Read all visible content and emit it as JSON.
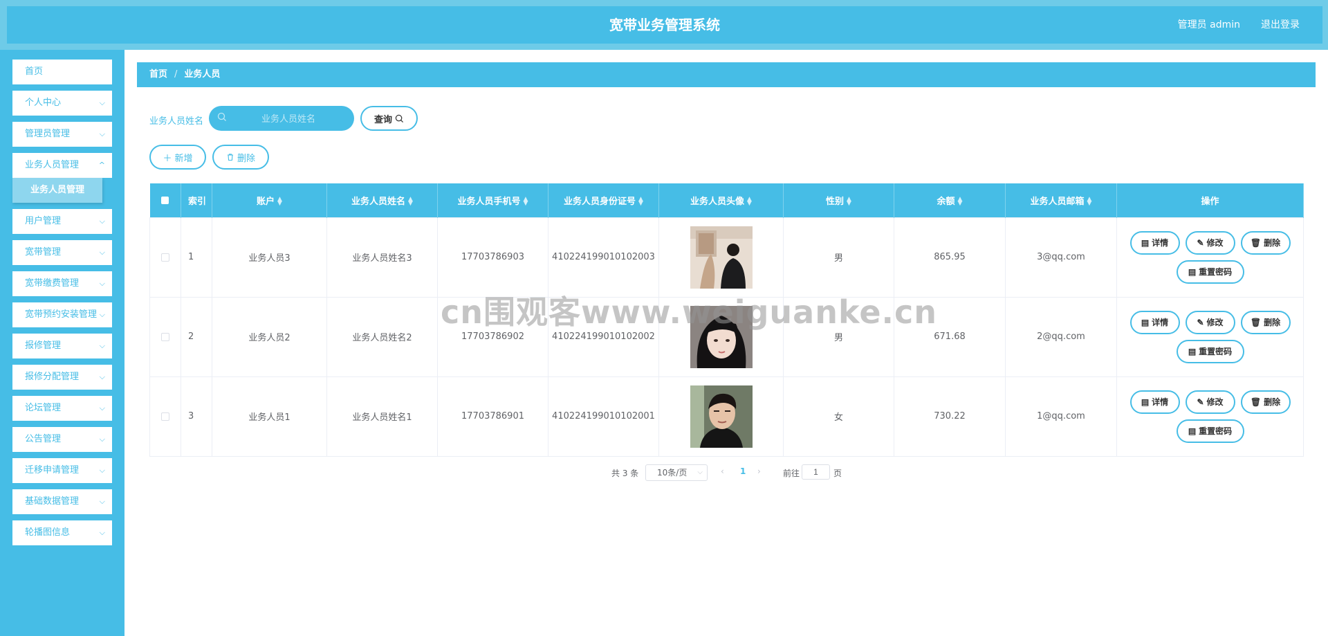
{
  "header": {
    "title": "宽带业务管理系统",
    "admin_label": "管理员 admin",
    "logout_label": "退出登录"
  },
  "sidebar": {
    "items": [
      {
        "label": "首页"
      },
      {
        "label": "个人中心"
      },
      {
        "label": "管理员管理"
      },
      {
        "label": "业务人员管理"
      },
      {
        "label": "用户管理"
      },
      {
        "label": "宽带管理"
      },
      {
        "label": "宽带缴费管理"
      },
      {
        "label": "宽带预约安装管理"
      },
      {
        "label": "报修管理"
      },
      {
        "label": "报修分配管理"
      },
      {
        "label": "论坛管理"
      },
      {
        "label": "公告管理"
      },
      {
        "label": "迁移申请管理"
      },
      {
        "label": "基础数据管理"
      },
      {
        "label": "轮播图信息"
      }
    ],
    "subitem": "业务人员管理"
  },
  "breadcrumb": {
    "home": "首页",
    "sep": "/",
    "current": "业务人员"
  },
  "search": {
    "label": "业务人员姓名",
    "placeholder": "业务人员姓名",
    "value": "",
    "button": "查询"
  },
  "actions": {
    "add": "新增",
    "delete": "删除"
  },
  "table": {
    "columns": [
      "索引",
      "账户",
      "业务人员姓名",
      "业务人员手机号",
      "业务人员身份证号",
      "业务人员头像",
      "性别",
      "余额",
      "业务人员邮箱",
      "操作"
    ],
    "rows": [
      {
        "index": "1",
        "account": "业务人员3",
        "name": "业务人员姓名3",
        "phone": "17703786903",
        "id_card": "410224199010102003",
        "gender": "男",
        "balance": "865.95",
        "email": "3@qq.com"
      },
      {
        "index": "2",
        "account": "业务人员2",
        "name": "业务人员姓名2",
        "phone": "17703786902",
        "id_card": "410224199010102002",
        "gender": "男",
        "balance": "671.68",
        "email": "2@qq.com"
      },
      {
        "index": "3",
        "account": "业务人员1",
        "name": "业务人员姓名1",
        "phone": "17703786901",
        "id_card": "410224199010102001",
        "gender": "女",
        "balance": "730.22",
        "email": "1@qq.com"
      }
    ],
    "row_ops": {
      "detail": "详情",
      "edit": "修改",
      "delete": "删除",
      "reset": "重置密码"
    }
  },
  "pagination": {
    "total": "共 3 条",
    "page_size": "10条/页",
    "current_page": "1",
    "goto_label": "前往",
    "goto_value": "1",
    "page_unit": "页"
  },
  "watermark": "cn围观客www.weiguanke.cn",
  "colors": {
    "primary": "#46bde6",
    "header_outer": "#6ecbe8",
    "submenu": "#8ed6ee"
  }
}
